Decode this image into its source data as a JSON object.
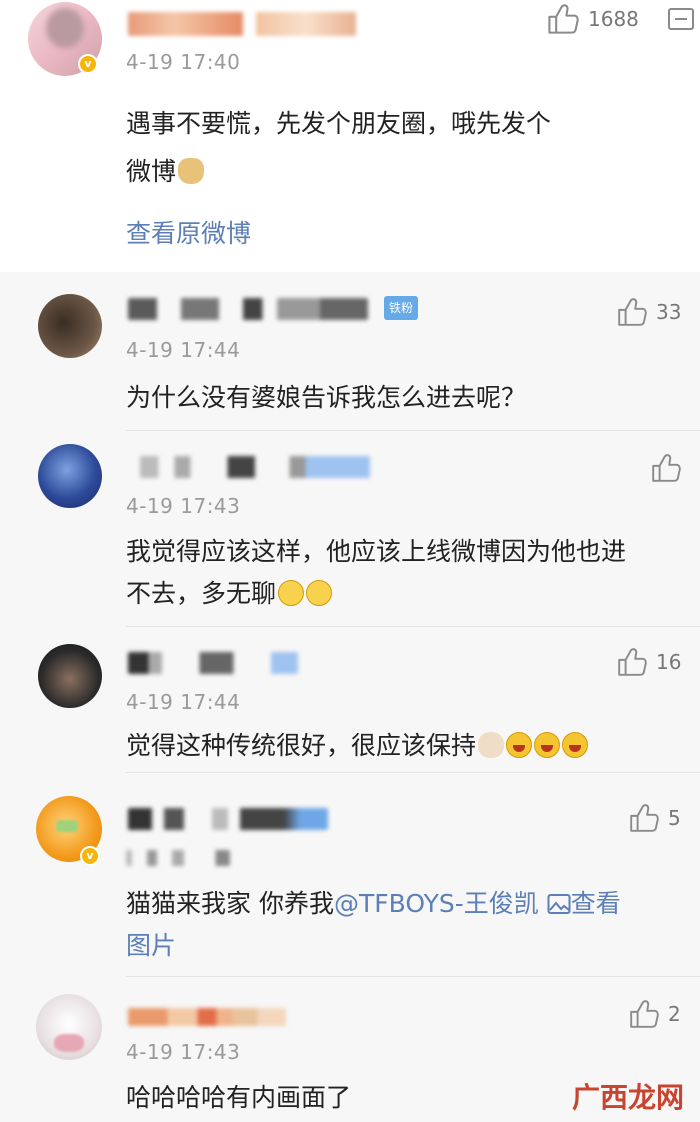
{
  "post": {
    "time": "4-19 17:40",
    "text_line1": "遇事不要慌，先发个朋友圈，哦先发个",
    "text_line2": "微博",
    "view_original": "查看原微博",
    "like_count": "1688"
  },
  "comments": [
    {
      "time": "4-19 17:44",
      "badge": "铁粉",
      "like_count": "33",
      "text": [
        "为什么没有婆娘告诉我怎么进去呢？"
      ]
    },
    {
      "time": "4-19 17:43",
      "like_count": "",
      "text": [
        "我觉得应该这样，他应该上线微博因为他也进",
        "不去，多无聊"
      ]
    },
    {
      "time": "4-19 17:44",
      "like_count": "16",
      "text": [
        "觉得这种传统很好，很应该保持"
      ]
    },
    {
      "time": "",
      "like_count": "5",
      "text_before": "猫猫来我家 你养我",
      "mention": "@TFBOYS-王俊凯",
      "view_image_1": "查看",
      "view_image_2": "图片"
    },
    {
      "time": "4-19 17:43",
      "like_count": "2",
      "text": [
        "哈哈哈哈有内画面了"
      ]
    }
  ],
  "watermark": "广西龙网",
  "colors": {
    "link": "#5b7fb6",
    "fans_badge": "#66a9e8",
    "vip_badge": "#f5b50a"
  },
  "icons": [
    "thumb-up-icon",
    "comment-icon",
    "image-icon",
    "verified-badge-icon"
  ]
}
